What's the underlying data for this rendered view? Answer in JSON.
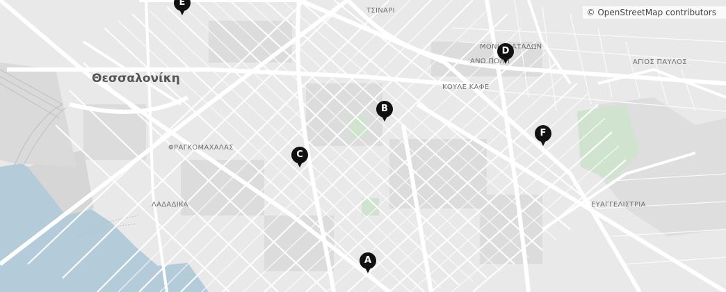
{
  "map": {
    "attribution": "© OpenStreetMap contributors",
    "city_label": "Θεσσαλονίκη",
    "colors": {
      "land": "#e9e9e9",
      "water": "#b4cbd9",
      "road": "#ffffff",
      "park": "#cfe3cf",
      "marker": "#111111"
    },
    "places": [
      {
        "key": "tsinari",
        "name": "ΤΣΙΝΑΡΙ"
      },
      {
        "key": "monti",
        "name": "ΜΟΝΙ ΒΛΑΤΑΔΩΝ"
      },
      {
        "key": "ano_poli",
        "name": "ΑΝΩ ΠΟΛΗ"
      },
      {
        "key": "agios_pavlos",
        "name": "ΑΓΙΟΣ ΠΑΥΛΟΣ"
      },
      {
        "key": "koule_kafe",
        "name": "ΚΟΥΛΕ ΚΑΦΕ"
      },
      {
        "key": "fragkomachalas",
        "name": "ΦΡΑΓΚΟΜΑΧΑΛΑΣ"
      },
      {
        "key": "ladadika",
        "name": "ΛΑΔΑΔΙΚΑ"
      },
      {
        "key": "evaggelistria",
        "name": "ΕΥΑΓΓΕΛΙΣΤΡΙΑ"
      }
    ],
    "markers": [
      {
        "label": "A"
      },
      {
        "label": "B"
      },
      {
        "label": "C"
      },
      {
        "label": "D"
      },
      {
        "label": "E"
      },
      {
        "label": "F"
      }
    ]
  }
}
